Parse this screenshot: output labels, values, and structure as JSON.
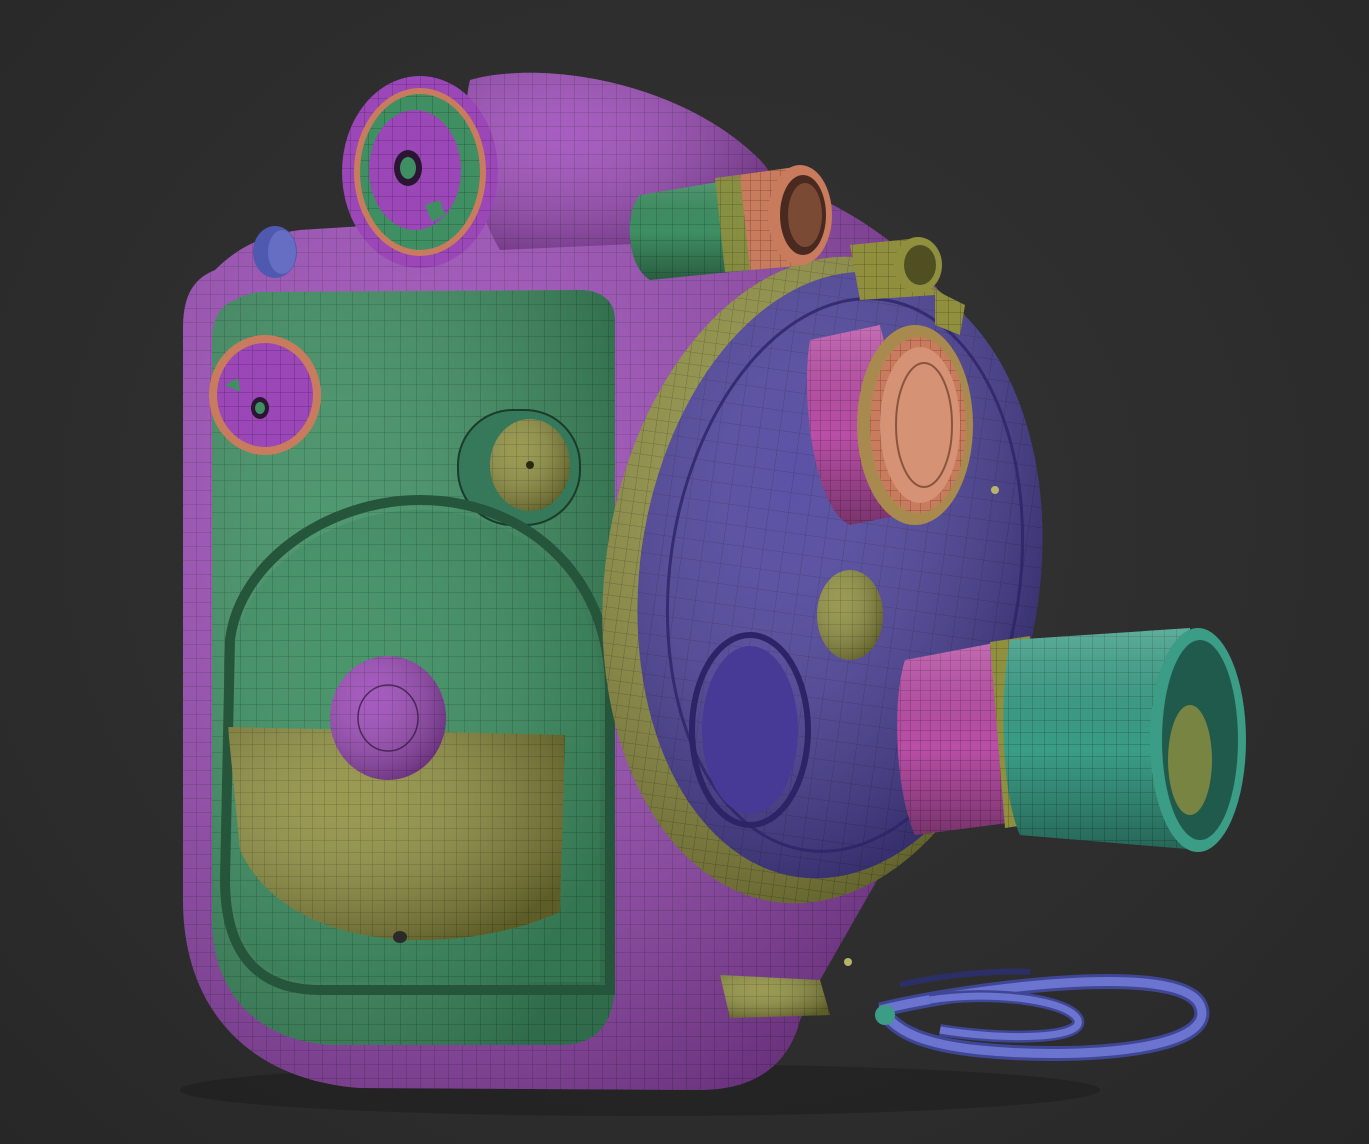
{
  "scene": {
    "subject": "sculpted-camera-model",
    "palette": {
      "background": "#2e2e2e",
      "body_purple": "#9b47b8",
      "panel_green": "#3f8f63",
      "plate_blue": "#4a3f9c",
      "olive": "#8f8f3e",
      "salmon": "#c97b5e",
      "pink": "#b94fa6",
      "teal": "#3b9d86",
      "cable_blue": "#5e68c4",
      "wire_line": "#1c1c24"
    }
  }
}
